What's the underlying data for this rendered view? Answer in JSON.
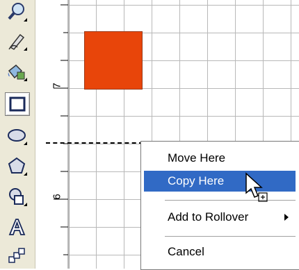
{
  "toolbox": {
    "tools": [
      {
        "name": "zoom-tool",
        "icon": "magnifier-icon"
      },
      {
        "name": "freehand-tool",
        "icon": "pen-icon"
      },
      {
        "name": "fill-tool",
        "icon": "fill-bucket-icon"
      },
      {
        "name": "rectangle-tool",
        "icon": "rectangle-icon",
        "selected": true
      },
      {
        "name": "ellipse-tool",
        "icon": "ellipse-icon"
      },
      {
        "name": "polygon-tool",
        "icon": "polygon-icon"
      },
      {
        "name": "basic-shapes-tool",
        "icon": "shapes-icon"
      },
      {
        "name": "text-tool",
        "icon": "text-a-icon"
      },
      {
        "name": "interactive-tool",
        "icon": "blend-icon"
      }
    ]
  },
  "ruler": {
    "labels": [
      "7",
      "6"
    ]
  },
  "canvas": {
    "shape_color": "#e8450a"
  },
  "context_menu": {
    "items": [
      {
        "label": "Move Here",
        "highlighted": false
      },
      {
        "label": "Copy Here",
        "highlighted": true
      },
      {
        "label": "Add to Rollover",
        "has_submenu": true
      },
      {
        "label": "Cancel"
      }
    ]
  }
}
